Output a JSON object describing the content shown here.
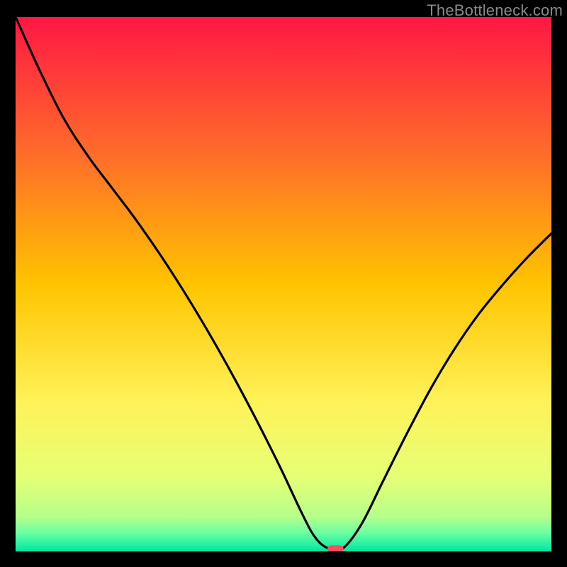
{
  "watermark": "TheBottleneck.com",
  "chart_data": {
    "type": "line",
    "title": "",
    "xlabel": "",
    "ylabel": "",
    "xlim": [
      0,
      100
    ],
    "ylim": [
      0,
      100
    ],
    "grid": false,
    "legend": null,
    "background_gradient": {
      "direction": "vertical",
      "stops": [
        {
          "offset": 0.0,
          "color": "#ff1744"
        },
        {
          "offset": 0.25,
          "color": "#ff6a2b"
        },
        {
          "offset": 0.5,
          "color": "#ffc400"
        },
        {
          "offset": 0.72,
          "color": "#fff259"
        },
        {
          "offset": 0.86,
          "color": "#e6ff75"
        },
        {
          "offset": 0.935,
          "color": "#b5ff8a"
        },
        {
          "offset": 0.965,
          "color": "#6bffa3"
        },
        {
          "offset": 1.0,
          "color": "#00e7a1"
        }
      ]
    },
    "series": [
      {
        "name": "bottleneck-curve",
        "color": "#000000",
        "type": "line",
        "x": [
          0.0,
          4.5,
          9.0,
          13.5,
          18.0,
          22.5,
          27.0,
          31.5,
          36.0,
          40.5,
          45.0,
          49.5,
          53.5,
          56.0,
          58.5,
          61.0,
          64.5,
          68.5,
          73.0,
          77.5,
          82.0,
          86.5,
          91.0,
          95.5,
          100.0
        ],
        "y": [
          100.0,
          90.0,
          81.0,
          74.0,
          68.0,
          62.0,
          55.5,
          48.5,
          41.0,
          33.0,
          24.5,
          15.5,
          7.0,
          2.5,
          0.5,
          0.5,
          5.0,
          13.0,
          22.0,
          30.5,
          38.0,
          44.5,
          50.0,
          55.0,
          59.5
        ]
      }
    ],
    "marker": {
      "name": "optimal-point",
      "shape": "pill",
      "x": 59.7,
      "y": 0.5,
      "width_pct": 3.0,
      "height_pct": 1.3,
      "fill": "#ff4d5e"
    }
  }
}
